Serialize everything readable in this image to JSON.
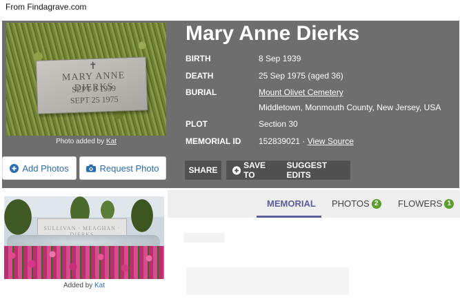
{
  "source_label": "From Findagrave.com",
  "memorial": {
    "name": "Mary Anne Dierks",
    "birth_label": "BIRTH",
    "birth": "8 Sep 1939",
    "death_label": "DEATH",
    "death": "25 Sep 1975 (aged 36)",
    "burial_label": "BURIAL",
    "burial_cemetery": "Mount Olivet Cemetery",
    "burial_location": "Middletown, Monmouth County, New Jersey, USA",
    "plot_label": "PLOT",
    "plot": "Section 30",
    "memorial_id_label": "MEMORIAL ID",
    "memorial_id": "152839021",
    "id_separator": "·",
    "view_source": "View Source"
  },
  "gravestone_text": {
    "line1": "MARY ANNE DIERKS",
    "line2": "SEPT 8 1939",
    "line3": "SEPT 25 1975"
  },
  "main_photo": {
    "caption_prefix": "Photo added by",
    "caption_author": "Kat"
  },
  "actions": {
    "share": "SHARE",
    "save_to": "SAVE TO",
    "suggest_edits": "SUGGEST EDITS",
    "add_photos": "Add Photos",
    "request_photo": "Request Photo"
  },
  "tabs": [
    {
      "label": "MEMORIAL",
      "active": true
    },
    {
      "label": "PHOTOS",
      "count": "2"
    },
    {
      "label": "FLOWERS",
      "count": "1"
    }
  ],
  "second_photo": {
    "headstone_text": "SULLIVAN · MEAGHAN · DIERKS",
    "caption_prefix": "Added by",
    "caption_author": "Kat"
  },
  "colors": {
    "panel": "#6e6e6e",
    "tab_active": "#5b5e9c",
    "badge": "#5aa02c",
    "link_blue": "#2a6db0"
  },
  "icons": {
    "add_photos": "plus-circle-icon",
    "request_photo": "camera-icon",
    "save_to": "plus-circle-icon"
  }
}
